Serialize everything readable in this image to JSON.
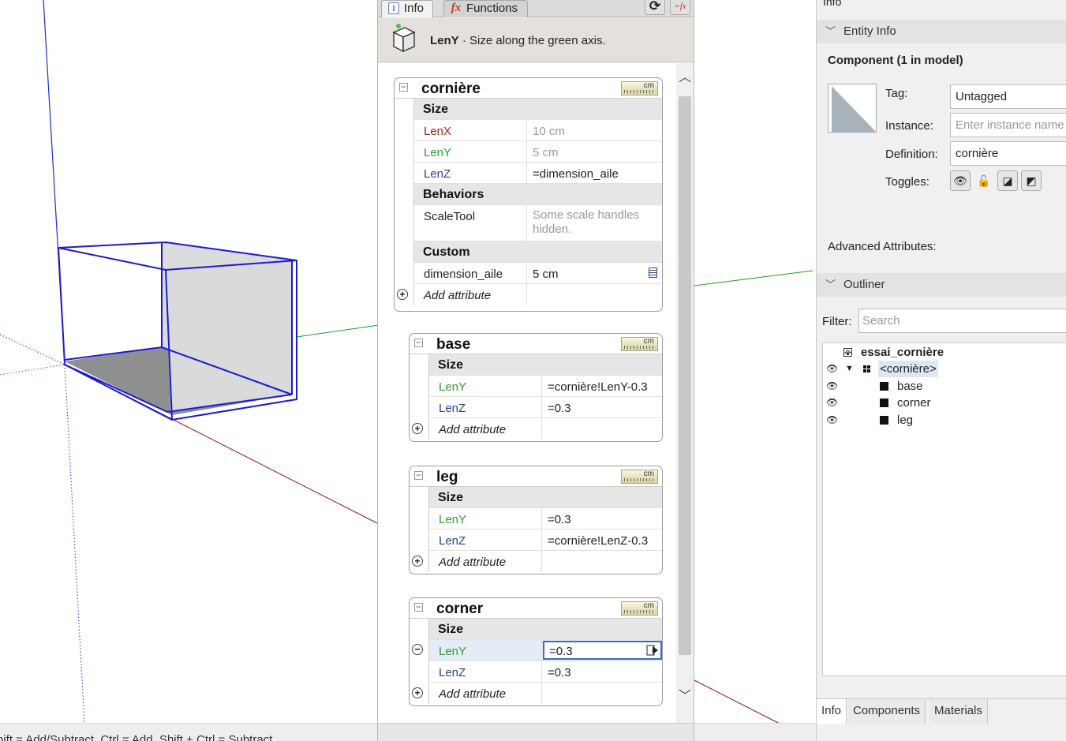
{
  "status_bar": {
    "text": "hift = Add/Subtract. Ctrl = Add. Shift + Ctrl = Subtract."
  },
  "attributes_panel": {
    "tabs": [
      {
        "label": "Info",
        "icon": "info-icon"
      },
      {
        "label": "Functions",
        "icon": "fx-icon"
      }
    ],
    "header": {
      "attribute": "LenY",
      "description": " · Size along the green axis."
    },
    "components": [
      {
        "name": "cornière",
        "unit": "cm",
        "sections": [
          {
            "title": "Size",
            "rows": [
              {
                "key": "LenX",
                "value": "10 cm",
                "color": "red",
                "muted": true
              },
              {
                "key": "LenY",
                "value": "5 cm",
                "color": "green",
                "muted": true
              },
              {
                "key": "LenZ",
                "value": "=dimension_aile",
                "color": "blue"
              }
            ]
          },
          {
            "title": "Behaviors",
            "rows": [
              {
                "key": "ScaleTool",
                "value": "Some scale handles hidden.",
                "muted": true
              }
            ]
          },
          {
            "title": "Custom",
            "rows": [
              {
                "key": "dimension_aile",
                "value": "5 cm"
              }
            ]
          }
        ],
        "add_label": "Add attribute"
      },
      {
        "name": "base",
        "unit": "cm",
        "sections": [
          {
            "title": "Size",
            "rows": [
              {
                "key": "LenY",
                "value": "=cornière!LenY-0.3",
                "color": "green"
              },
              {
                "key": "LenZ",
                "value": "=0.3",
                "color": "blue"
              }
            ]
          }
        ],
        "add_label": "Add attribute"
      },
      {
        "name": "leg",
        "unit": "cm",
        "sections": [
          {
            "title": "Size",
            "rows": [
              {
                "key": "LenY",
                "value": "=0.3",
                "color": "green"
              },
              {
                "key": "LenZ",
                "value": "=cornière!LenZ-0.3",
                "color": "blue"
              }
            ]
          }
        ],
        "add_label": "Add attribute"
      },
      {
        "name": "corner",
        "unit": "cm",
        "sections": [
          {
            "title": "Size",
            "rows": [
              {
                "key": "LenY",
                "value": "=0.3",
                "color": "green",
                "selected": true
              },
              {
                "key": "LenZ",
                "value": "=0.3",
                "color": "blue"
              }
            ]
          }
        ],
        "add_label": "Add attribute"
      }
    ]
  },
  "right_panel": {
    "title": "Info",
    "entity_info": {
      "section_label": "Entity Info",
      "header": "Component (1 in model)",
      "tag_label": "Tag:",
      "tag_value": "Untagged",
      "instance_label": "Instance:",
      "instance_placeholder": "Enter instance name",
      "definition_label": "Definition:",
      "definition_value": "cornière",
      "toggles_label": "Toggles:",
      "advanced_label": "Advanced Attributes:"
    },
    "outliner": {
      "section_label": "Outliner",
      "filter_label": "Filter:",
      "search_placeholder": "Search",
      "root": "essai_cornière",
      "items": [
        {
          "label": "<cornière>",
          "level": 1,
          "selected": true
        },
        {
          "label": "base",
          "level": 2
        },
        {
          "label": "corner",
          "level": 2
        },
        {
          "label": "leg",
          "level": 2
        }
      ]
    },
    "tabs": [
      "Info",
      "Components",
      "Materials"
    ]
  }
}
